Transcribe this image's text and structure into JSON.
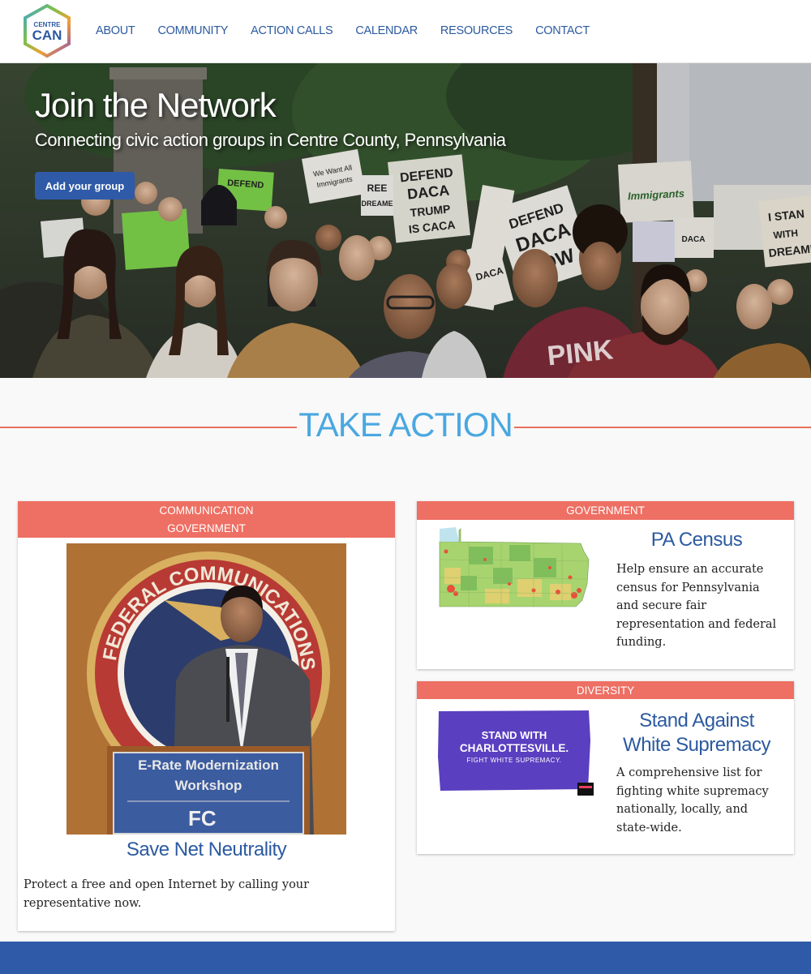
{
  "logo": {
    "line1": "CENTRE",
    "line2": "CAN"
  },
  "nav": {
    "items": [
      "ABOUT",
      "COMMUNITY",
      "ACTION CALLS",
      "CALENDAR",
      "RESOURCES",
      "CONTACT"
    ]
  },
  "hero": {
    "title": "Join the Network",
    "subtitle": "Connecting civic action groups in Centre County, Pennsylvania",
    "button": "Add your group",
    "signs": [
      "DEFEND DACA TRUMP IS CACA",
      "DEFEND DACA NOW",
      "I STAND WITH DREAMERS",
      "REE DREAME",
      "Immigrants",
      "DEFEND",
      "PINK"
    ]
  },
  "section": {
    "title": "TAKE ACTION"
  },
  "cards": [
    {
      "categories": [
        "COMMUNICATION",
        "GOVERNMENT"
      ],
      "image_text": {
        "seal": "FEDERAL COMMUNICATIONS",
        "podium_line1": "E-Rate Modernization",
        "podium_line2": "Workshop",
        "podium_logo": "FC"
      },
      "title": "Save Net Neutrality",
      "description": "Protect a free and open Internet by calling your representative now."
    },
    {
      "categories": [
        "GOVERNMENT"
      ],
      "title": "PA Census",
      "description": "Help ensure an accurate census for Pennsylvania and secure fair representation and federal funding."
    },
    {
      "categories": [
        "DIVERSITY"
      ],
      "image_text": {
        "line1": "STAND WITH",
        "line2": "CHARLOTTESVILLE.",
        "line3": "FIGHT WHITE SUPREMACY."
      },
      "title": "Stand Against White Supremacy",
      "description": "A comprehensive list for fighting white supremacy nationally, locally, and state-wide."
    }
  ],
  "colors": {
    "brand_blue": "#2c5aa0",
    "accent_coral": "#ee6f63",
    "heading_sky": "#4aa8e0",
    "footer_blue": "#2f5aa8"
  }
}
